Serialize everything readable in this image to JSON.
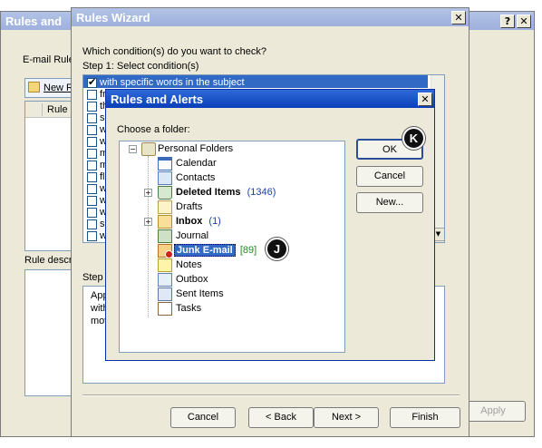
{
  "rules_win": {
    "title": "Rules and",
    "help": "?",
    "close": "✕",
    "tab_label": "E-mail Rule",
    "new_rule": "New R",
    "col_rule": "Rule (",
    "rule_desc": "Rule descr",
    "apply": "Apply"
  },
  "wizard": {
    "title": "Rules Wizard",
    "close": "✕",
    "question": "Which condition(s) do you want to check?",
    "step1": "Step 1: Select condition(s)",
    "conditions": [
      {
        "text": "with specific words in the subject",
        "checked": true
      },
      {
        "text": "fr",
        "checked": false
      },
      {
        "text": "th",
        "checked": false
      },
      {
        "text": "se",
        "checked": false
      },
      {
        "text": "w",
        "checked": false
      },
      {
        "text": "w",
        "checked": false
      },
      {
        "text": "m",
        "checked": false
      },
      {
        "text": "m",
        "checked": false
      },
      {
        "text": "fl",
        "checked": false
      },
      {
        "text": "w",
        "checked": false
      },
      {
        "text": "w",
        "checked": false
      },
      {
        "text": "w",
        "checked": false
      },
      {
        "text": "se",
        "checked": false
      },
      {
        "text": "w",
        "checked": false
      }
    ],
    "step2": "Step",
    "desc_lines": [
      "App",
      "with",
      "mov"
    ],
    "cancel": "Cancel",
    "back": "< Back",
    "next": "Next >",
    "finish": "Finish"
  },
  "alerts": {
    "title": "Rules and Alerts",
    "close": "✕",
    "choose": "Choose a folder:",
    "ok": "OK",
    "cancel": "Cancel",
    "new": "New...",
    "tree": {
      "root": "Personal Folders",
      "calendar": "Calendar",
      "contacts": "Contacts",
      "deleted": "Deleted Items",
      "deleted_count": "(1346)",
      "drafts": "Drafts",
      "inbox": "Inbox",
      "inbox_count": "(1)",
      "journal": "Journal",
      "junk": "Junk E-mail",
      "junk_count": "[89]",
      "notes": "Notes",
      "outbox": "Outbox",
      "sent": "Sent Items",
      "tasks": "Tasks"
    }
  },
  "callouts": {
    "k": "K",
    "j": "J"
  }
}
